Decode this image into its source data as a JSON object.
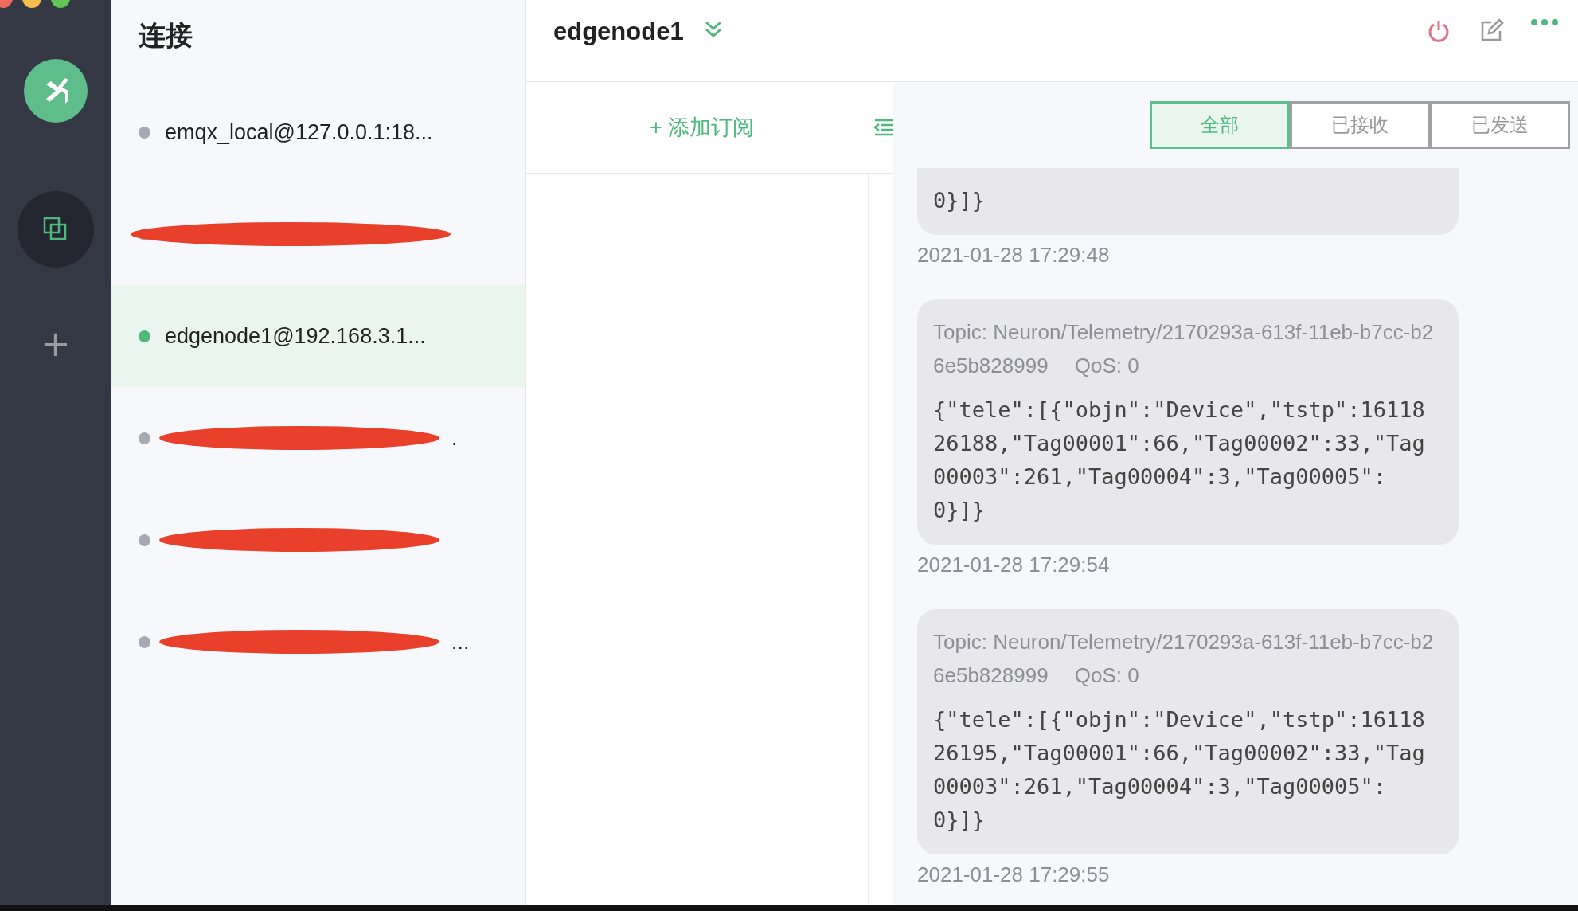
{
  "sidebar": {
    "add_label": "+"
  },
  "connections_panel": {
    "title": "连接",
    "items": [
      {
        "name": "emqx_local@127.0.0.1:18...",
        "online": false,
        "redacted": false,
        "selected": false
      },
      {
        "online": false,
        "redacted": true,
        "selected": false
      },
      {
        "name": "edgenode1@192.168.3.1...",
        "online": true,
        "redacted": false,
        "selected": true
      },
      {
        "name": ".",
        "online": false,
        "redacted": true,
        "selected": false
      },
      {
        "online": false,
        "redacted": true,
        "selected": false
      },
      {
        "name": "...",
        "online": false,
        "redacted": true,
        "selected": false
      }
    ]
  },
  "header": {
    "title": "edgenode1"
  },
  "subscriptions": {
    "add_button": "+ 添加订阅"
  },
  "filter_tabs": [
    {
      "label": "全部",
      "selected": true
    },
    {
      "label": "已接收",
      "selected": false
    },
    {
      "label": "已发送",
      "selected": false
    }
  ],
  "messages": [
    {
      "body": "0}]}",
      "time": "2021-01-28 17:29:48"
    },
    {
      "topic": "Topic: Neuron/Telemetry/2170293a-613f-11eb-b7cc-b26e5b828999",
      "qos": "QoS: 0",
      "body": "{\"tele\":[{\"objn\":\"Device\",\"tstp\":1611826188,\"Tag00001\":66,\"Tag00002\":33,\"Tag00003\":261,\"Tag00004\":3,\"Tag00005\":0}]}",
      "time": "2021-01-28 17:29:54"
    },
    {
      "topic": "Topic: Neuron/Telemetry/2170293a-613f-11eb-b7cc-b26e5b828999",
      "qos": "QoS: 0",
      "body": "{\"tele\":[{\"objn\":\"Device\",\"tstp\":1611826195,\"Tag00001\":66,\"Tag00002\":33,\"Tag00003\":261,\"Tag00004\":3,\"Tag00005\":0}]}",
      "time": "2021-01-28 17:29:55"
    }
  ]
}
